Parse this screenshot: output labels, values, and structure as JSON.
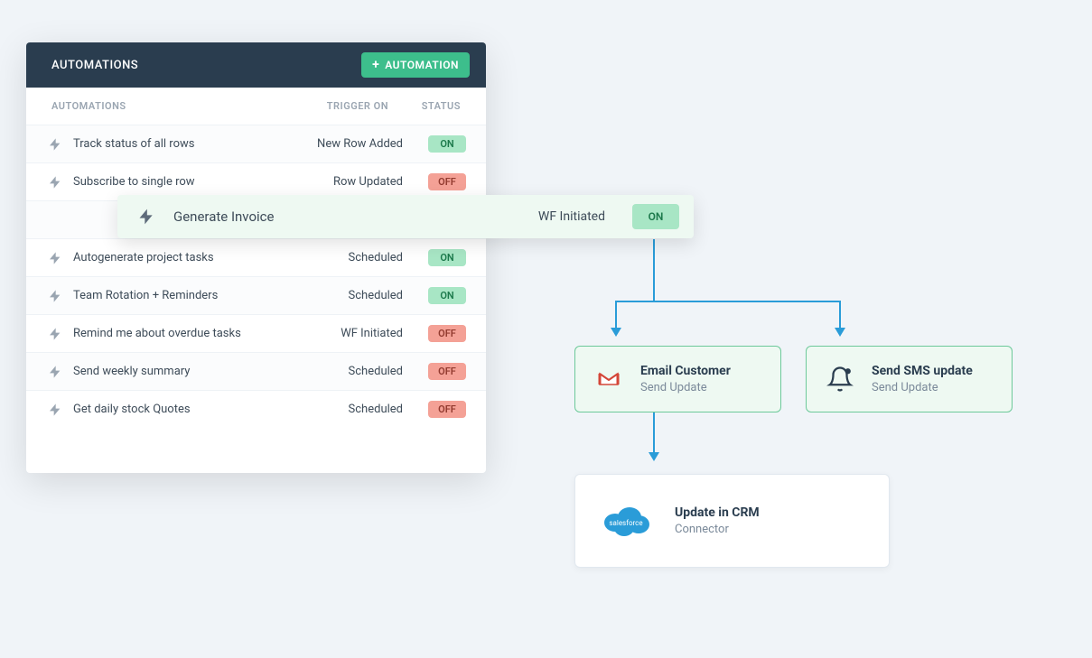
{
  "panel": {
    "title": "AUTOMATIONS",
    "addButton": "AUTOMATION",
    "headers": {
      "name": "AUTOMATIONS",
      "trigger": "TRIGGER ON",
      "status": "STATUS"
    },
    "rows": [
      {
        "name": "Track status of all rows",
        "trigger": "New Row Added",
        "status": "ON"
      },
      {
        "name": "Subscribe to single row",
        "trigger": "Row Updated",
        "status": "OFF"
      },
      {
        "name": "Autogenerate project tasks",
        "trigger": "Scheduled",
        "status": "ON"
      },
      {
        "name": "Team Rotation + Reminders",
        "trigger": "Scheduled",
        "status": "ON"
      },
      {
        "name": "Remind me about overdue tasks",
        "trigger": "WF Initiated",
        "status": "OFF"
      },
      {
        "name": "Send weekly summary",
        "trigger": "Scheduled",
        "status": "OFF"
      },
      {
        "name": "Get daily stock Quotes",
        "trigger": "Scheduled",
        "status": "OFF"
      }
    ]
  },
  "highlighted": {
    "name": "Generate Invoice",
    "trigger": "WF Initiated",
    "status": "ON"
  },
  "actions": {
    "email": {
      "title": "Email Customer",
      "subtitle": "Send Update"
    },
    "sms": {
      "title": "Send SMS update",
      "subtitle": "Send Update"
    },
    "crm": {
      "title": "Update in CRM",
      "subtitle": "Connector"
    }
  }
}
